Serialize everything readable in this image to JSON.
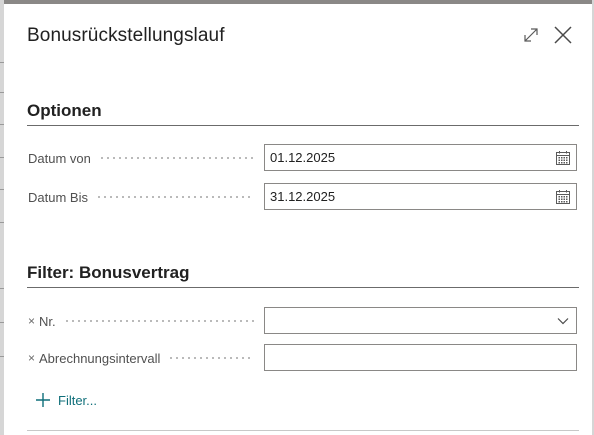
{
  "dialog": {
    "title": "Bonusrückstellungslauf",
    "expand_icon": "expand-icon",
    "close_icon": "close-icon"
  },
  "options": {
    "title": "Optionen",
    "fields": [
      {
        "label": "Datum von",
        "value": "01.12.2025",
        "icon": "calendar-icon"
      },
      {
        "label": "Datum Bis",
        "value": "31.12.2025",
        "icon": "calendar-icon"
      }
    ]
  },
  "filter": {
    "title": "Filter: Bonusvertrag",
    "fields": [
      {
        "remove": "×",
        "label": "Nr.",
        "value": "",
        "icon": "chevron-down-icon"
      },
      {
        "remove": "×",
        "label": "Abrechnungsintervall",
        "value": ""
      }
    ],
    "add_label": "Filter...",
    "add_icon": "plus-icon"
  },
  "colors": {
    "accent": "#0f6f7a",
    "border": "#8a8886",
    "label": "#505050"
  }
}
